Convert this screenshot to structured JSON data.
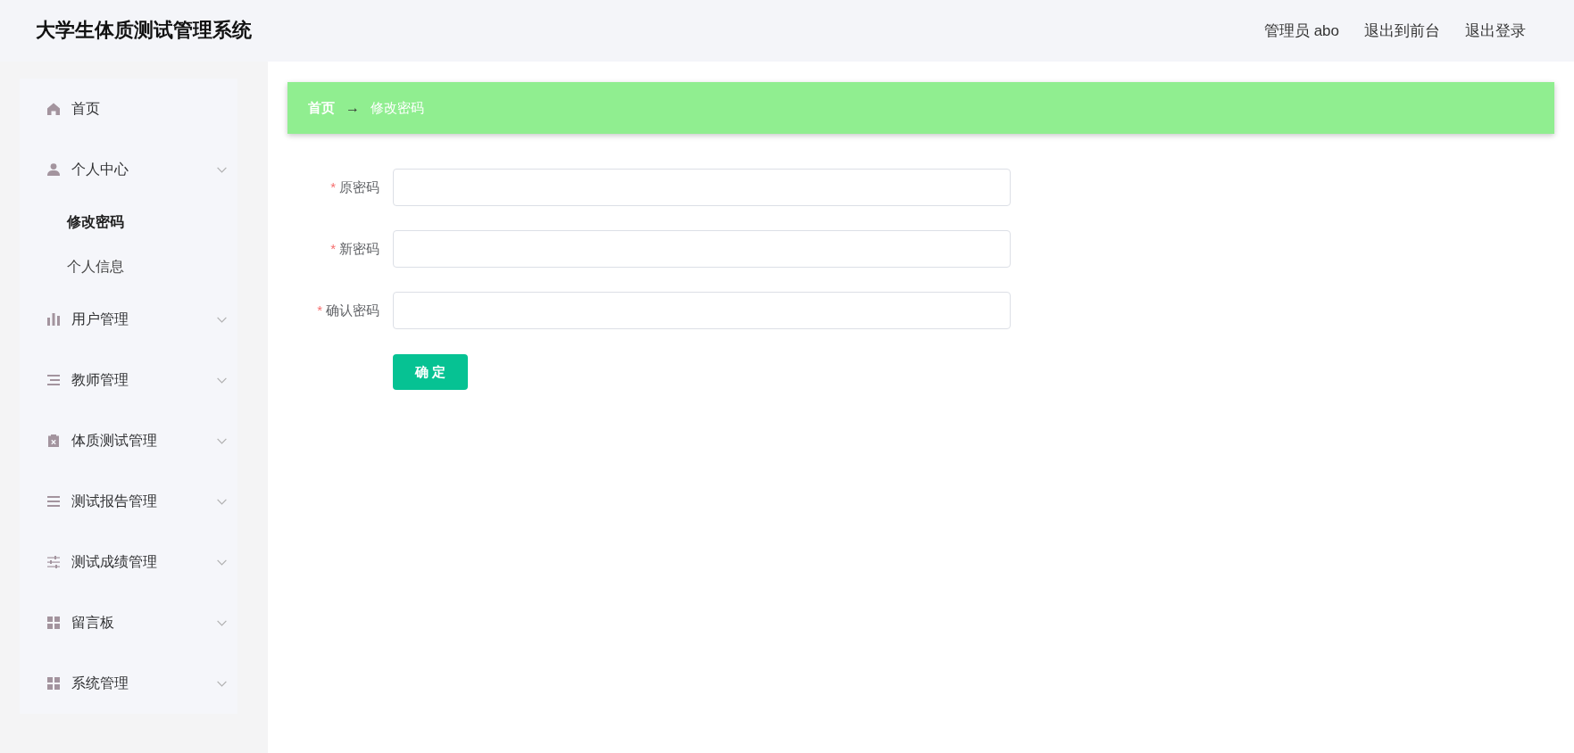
{
  "header": {
    "title": "大学生体质测试管理系统",
    "user_label": "管理员 abo",
    "links": [
      {
        "label": "退出到前台"
      },
      {
        "label": "退出登录"
      }
    ]
  },
  "sidebar": {
    "items": [
      {
        "label": "首页",
        "kind": "link",
        "selected": false
      },
      {
        "label": "个人中心",
        "kind": "submenu",
        "selected": false,
        "children": [
          {
            "label": "修改密码",
            "selected": true
          },
          {
            "label": "个人信息",
            "selected": false
          }
        ]
      },
      {
        "label": "用户管理",
        "kind": "submenu",
        "selected": false
      },
      {
        "label": "教师管理",
        "kind": "submenu",
        "selected": false
      },
      {
        "label": "体质测试管理",
        "kind": "submenu",
        "selected": false
      },
      {
        "label": "测试报告管理",
        "kind": "submenu",
        "selected": false
      },
      {
        "label": "测试成绩管理",
        "kind": "submenu",
        "selected": false
      },
      {
        "label": "留言板",
        "kind": "submenu",
        "selected": false
      },
      {
        "label": "系统管理",
        "kind": "submenu",
        "selected": false
      }
    ]
  },
  "breadcrumb": {
    "separator": "→",
    "items": [
      {
        "label": "首页",
        "current": false
      },
      {
        "label": "修改密码",
        "current": true
      }
    ]
  },
  "form": {
    "required_mark": "*",
    "fields": [
      {
        "label": "原密码",
        "required": true
      },
      {
        "label": "新密码",
        "required": true
      },
      {
        "label": "确认密码",
        "required": true
      }
    ],
    "submit": {
      "label": "确 定"
    }
  }
}
